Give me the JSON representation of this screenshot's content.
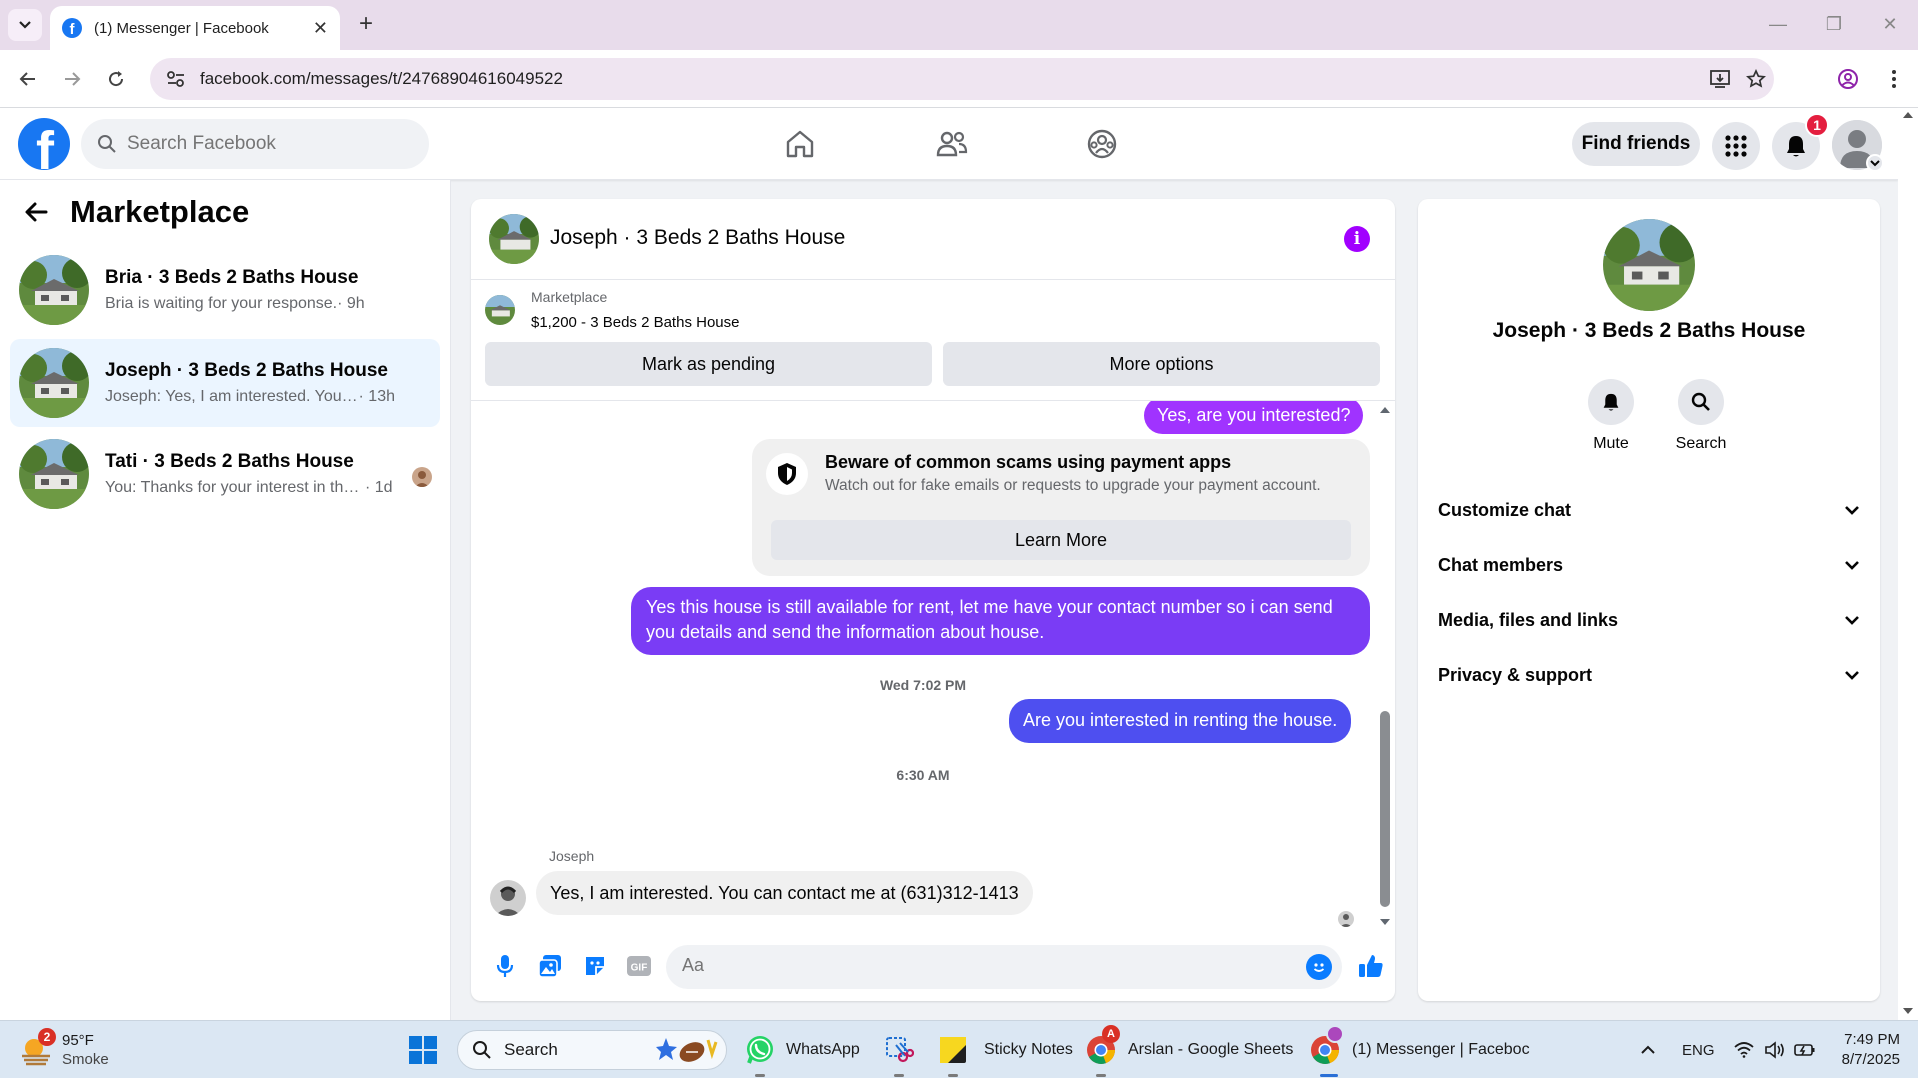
{
  "browser": {
    "tab_title": "(1) Messenger | Facebook",
    "url": "facebook.com/messages/t/24768904616049522"
  },
  "fb": {
    "search_placeholder": "Search Facebook",
    "find_friends": "Find friends",
    "notification_count": "1"
  },
  "left": {
    "title": "Marketplace",
    "conversations": [
      {
        "name": "Bria · 3 Beds 2 Baths House",
        "preview": "Bria is waiting for your response.",
        "time": " · 9h",
        "active": false
      },
      {
        "name": "Joseph · 3 Beds 2 Baths House",
        "preview": "Joseph: Yes, I am interested. You can ...",
        "time": " · 13h",
        "active": true
      },
      {
        "name": "Tati · 3 Beds 2 Baths House",
        "preview": "You: Thanks for your interest in the...",
        "time": " · 1d",
        "active": false
      }
    ]
  },
  "chat": {
    "title": "Joseph · 3 Beds 2 Baths House",
    "marketplace_label": "Marketplace",
    "listing": "$1,200 - 3 Beds 2 Baths House",
    "mark_pending": "Mark as pending",
    "more_options": "More options",
    "msg_out_1": "Yes, are you interested?",
    "warning_title": "Beware of common scams using payment apps",
    "warning_sub": "Watch out for fake emails or requests to upgrade your payment account.",
    "learn_more": "Learn More",
    "msg_out_2": "Yes this house is still available for rent, let me have your contact number so i can send you details and send the information about house.",
    "ts_1": "Wed 7:02 PM",
    "msg_out_3": "Are you interested in renting the house.",
    "ts_2": "6:30 AM",
    "sender": "Joseph",
    "msg_in_1": "Yes, I am interested. You can contact me at (631)312-1413",
    "composer_placeholder": "Aa"
  },
  "right": {
    "name": "Joseph · 3 Beds 2 Baths House",
    "mute": "Mute",
    "search": "Search",
    "sections": [
      "Customize chat",
      "Chat members",
      "Media, files and links",
      "Privacy & support"
    ]
  },
  "taskbar": {
    "weather_temp": "95°F",
    "weather_desc": "Smoke",
    "weather_badge": "2",
    "search": "Search",
    "whatsapp": "WhatsApp",
    "sticky": "Sticky Notes",
    "sheets": "Arslan - Google Sheets",
    "messenger": "(1) Messenger | Faceboc",
    "lang": "ENG",
    "time": "7:49 PM",
    "date": "8/7/2025"
  },
  "colors": {
    "fb_blue": "#1877f2",
    "bubble_purple": "#a033ff",
    "bubble_violet": "#7a3cf5",
    "bubble_blue": "#4e4ff0",
    "info_purple": "#a100ff"
  }
}
